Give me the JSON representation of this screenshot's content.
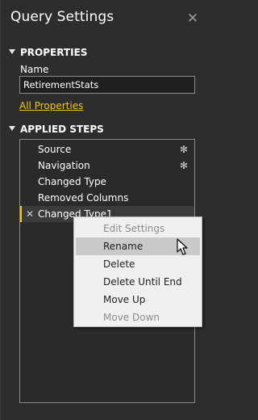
{
  "panel": {
    "title": "Query Settings",
    "close_icon": "close-icon"
  },
  "properties": {
    "header": "PROPERTIES",
    "name_label": "Name",
    "name_value": "RetirementStats",
    "all_properties_link": "All Properties"
  },
  "applied_steps": {
    "header": "APPLIED STEPS",
    "steps": [
      {
        "label": "Source",
        "has_gear": true
      },
      {
        "label": "Navigation",
        "has_gear": true
      },
      {
        "label": "Changed Type",
        "has_gear": false
      },
      {
        "label": "Removed Columns",
        "has_gear": false
      },
      {
        "label": "Changed Type1",
        "has_gear": false,
        "selected": true
      }
    ]
  },
  "context_menu": {
    "items": [
      {
        "label": "Edit Settings",
        "enabled": false
      },
      {
        "label": "Rename",
        "enabled": true,
        "hovered": true
      },
      {
        "label": "Delete",
        "enabled": true
      },
      {
        "label": "Delete Until End",
        "enabled": true
      },
      {
        "label": "Move Up",
        "enabled": true
      },
      {
        "label": "Move Down",
        "enabled": false
      }
    ]
  },
  "colors": {
    "background": "#2d2d2d",
    "accent": "#f2c811",
    "menu_background": "#f0f0f0",
    "menu_hover": "#c9c9c9"
  }
}
